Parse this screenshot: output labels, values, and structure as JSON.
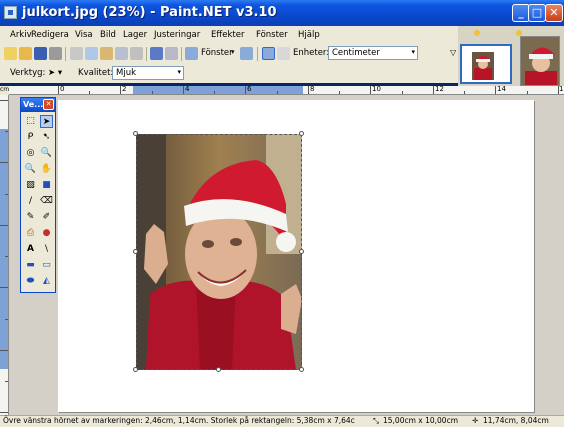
{
  "window": {
    "title": "julkort.jpg (23%) - Paint.NET v3.10",
    "buttons": {
      "minimize": "_",
      "maximize": "□",
      "close": "✕"
    }
  },
  "menu": [
    "Arkiv",
    "Redigera",
    "Visa",
    "Bild",
    "Lager",
    "Justeringar",
    "Effekter",
    "Fönster",
    "Hjälp"
  ],
  "toolbar": {
    "zoom_label": "Fönster",
    "units_label": "Enheter:",
    "units_value": "Centimeter",
    "tool_label": "Verktyg:",
    "quality_label": "Kvalitet:",
    "quality_value": "Mjuk"
  },
  "rulers": {
    "corner": "cm",
    "h_labels": [
      "0",
      "2",
      "4",
      "6",
      "8",
      "10",
      "12",
      "14",
      "16"
    ],
    "v_labels": [
      "0",
      "2",
      "4",
      "6",
      "8",
      "10",
      "12"
    ]
  },
  "tools_window": {
    "title": "Ve...",
    "close": "✕"
  },
  "tools": [
    "⬚",
    "➤",
    "ᑭ",
    "➷",
    "◎",
    "🔍",
    "🔍",
    "✋",
    "▧",
    "■",
    "/",
    "⌫",
    "✎",
    "✐",
    "⎙",
    "●",
    "A",
    "\\",
    "▬",
    "▭",
    "⬬",
    "◭"
  ],
  "status": {
    "selection": "Övre vänstra hörnet av markeringen: 2,46cm, 1,14cm. Storlek på rektangeln: 5,38cm x 7,64c",
    "image_size": "15,00cm x 10,00cm",
    "cursor": "11,74cm, 8,04cm"
  },
  "colors": {
    "title_bar": "#0a46c8",
    "chrome": "#ece9d8",
    "selection_blue": "#316ac5"
  }
}
